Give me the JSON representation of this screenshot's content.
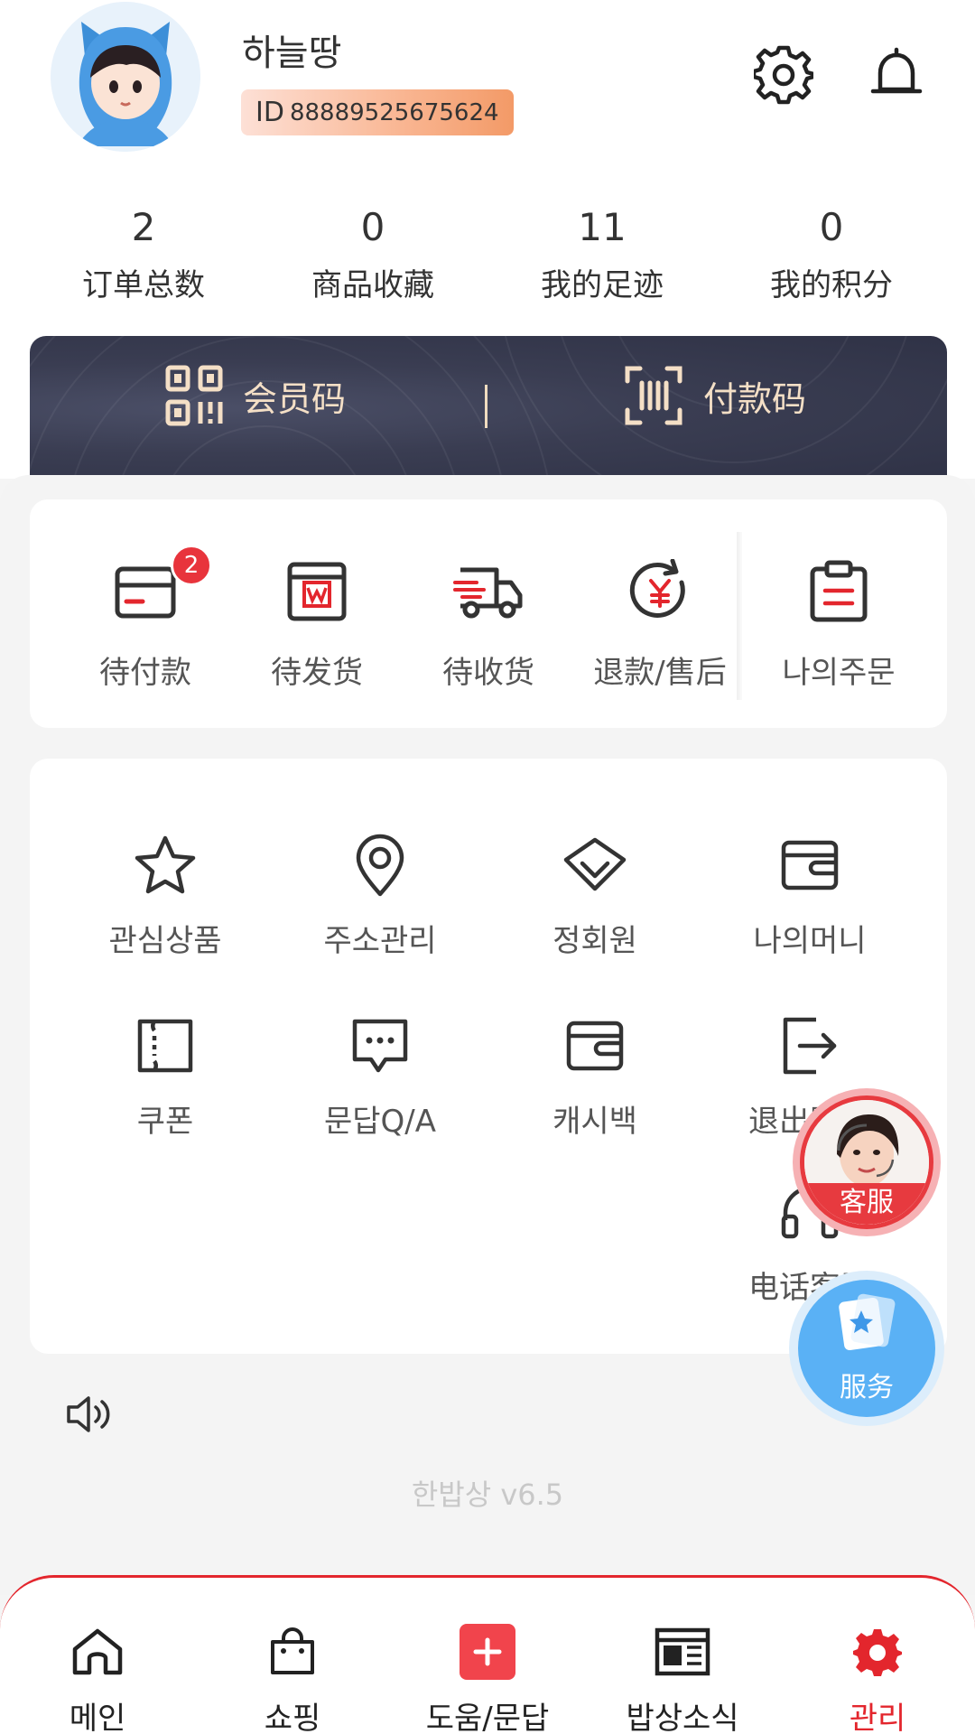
{
  "profile": {
    "username": "하늘땅",
    "id_label": "ID",
    "id_value": "88889525675624"
  },
  "header_icons": [
    "gear-icon",
    "bell-icon"
  ],
  "stats": [
    {
      "value": "2",
      "label": "订单总数"
    },
    {
      "value": "0",
      "label": "商品收藏"
    },
    {
      "value": "11",
      "label": "我的足迹"
    },
    {
      "value": "0",
      "label": "我的积分"
    }
  ],
  "codes": {
    "member_code": "会员码",
    "payment_code": "付款码"
  },
  "orders": {
    "items": [
      {
        "label": "待付款",
        "icon": "card-icon",
        "badge": "2"
      },
      {
        "label": "待发货",
        "icon": "package-icon"
      },
      {
        "label": "待收货",
        "icon": "truck-icon"
      },
      {
        "label": "退款/售后",
        "icon": "refund-icon"
      }
    ],
    "my_orders": "나의주문"
  },
  "tools": [
    {
      "label": "관심상품",
      "icon": "star-icon"
    },
    {
      "label": "주소관리",
      "icon": "location-icon"
    },
    {
      "label": "정회원",
      "icon": "diamond-icon"
    },
    {
      "label": "나의머니",
      "icon": "wallet-icon"
    },
    {
      "label": "쿠폰",
      "icon": "coupon-icon"
    },
    {
      "label": "문답Q/A",
      "icon": "chat-icon"
    },
    {
      "label": "캐시백",
      "icon": "wallet-icon"
    },
    {
      "label": "退出账号",
      "icon": "logout-icon"
    },
    {
      "label": "电话客服",
      "icon": "headset-icon"
    }
  ],
  "floating": {
    "customer_service": "客服",
    "service": "服务"
  },
  "version": "한밥상 v6.5",
  "nav": [
    {
      "label": "메인",
      "icon": "home-icon"
    },
    {
      "label": "쇼핑",
      "icon": "shopping-bag-icon"
    },
    {
      "label": "도움/문답",
      "icon": "plus-icon"
    },
    {
      "label": "밥상소식",
      "icon": "news-icon"
    },
    {
      "label": "관리",
      "icon": "gear-icon",
      "active": true
    }
  ],
  "colors": {
    "accent_red": "#e3262d",
    "banner_dark": "#363a50",
    "banner_gold": "#f4dfc6",
    "service_blue": "#5ab1f5"
  }
}
